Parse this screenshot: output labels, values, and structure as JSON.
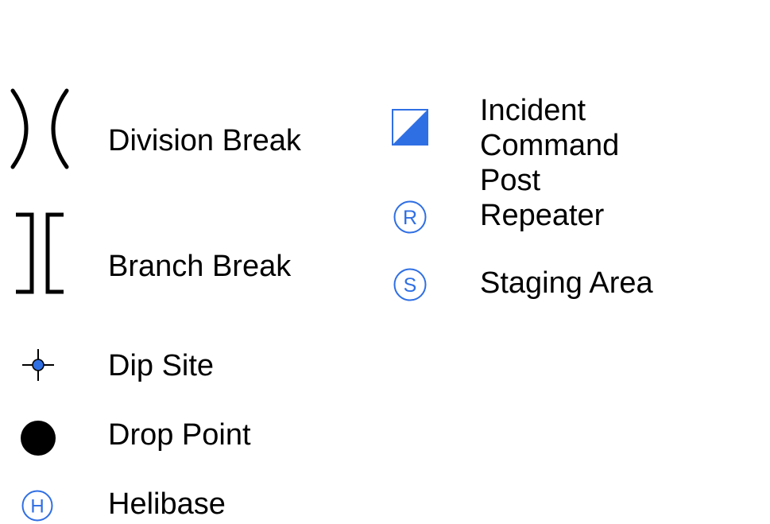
{
  "legend": {
    "items": [
      {
        "id": "division-break",
        "label": "Division Break",
        "icon": "division-break-icon"
      },
      {
        "id": "branch-break",
        "label": "Branch Break",
        "icon": "branch-break-icon"
      },
      {
        "id": "dip-site",
        "label": "Dip Site",
        "icon": "dip-site-icon"
      },
      {
        "id": "drop-point",
        "label": "Drop Point",
        "icon": "drop-point-icon"
      },
      {
        "id": "helibase",
        "label": "Helibase",
        "icon": "helibase-icon",
        "letter": "H"
      },
      {
        "id": "incident-command-post",
        "label_lines": [
          "Incident",
          "Command Post"
        ],
        "icon": "incident-command-post-icon"
      },
      {
        "id": "repeater",
        "label": "Repeater",
        "icon": "repeater-icon",
        "letter": "R"
      },
      {
        "id": "staging-area",
        "label": "Staging Area",
        "icon": "staging-area-icon",
        "letter": "S"
      }
    ],
    "colors": {
      "text": "#000000",
      "symbol_blue": "#2f6fe4",
      "symbol_black": "#000000"
    }
  }
}
